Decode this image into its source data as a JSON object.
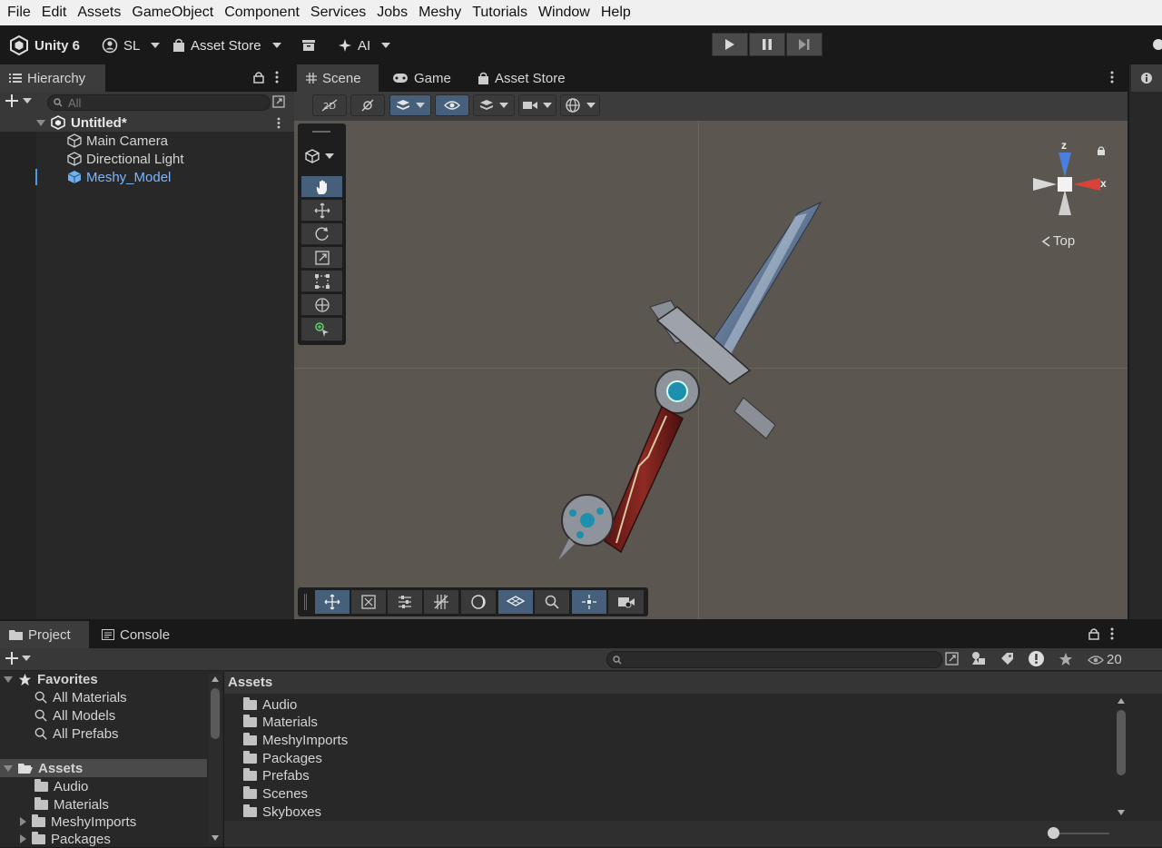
{
  "menu": [
    "File",
    "Edit",
    "Assets",
    "GameObject",
    "Component",
    "Services",
    "Jobs",
    "Meshy",
    "Tutorials",
    "Window",
    "Help"
  ],
  "toolbar": {
    "app_label": "Unity 6",
    "account_label": "SL",
    "asset_store_label": "Asset Store",
    "ai_label": "AI"
  },
  "hierarchy": {
    "tab_label": "Hierarchy",
    "search_placeholder": "All",
    "scene_name": "Untitled*",
    "items": [
      "Main Camera",
      "Directional Light",
      "Meshy_Model"
    ],
    "selected_item": "Meshy_Model"
  },
  "scene_tabs": [
    "Scene",
    "Game",
    "Asset Store"
  ],
  "gizmo": {
    "z_label": "z",
    "x_label": "x",
    "view_label": "Top"
  },
  "project": {
    "tabs": [
      "Project",
      "Console"
    ],
    "visible_count": "20",
    "favorites_label": "Favorites",
    "favorites": [
      "All Materials",
      "All Models",
      "All Prefabs"
    ],
    "assets_label": "Assets",
    "tree_assets": [
      "Audio",
      "Materials",
      "MeshyImports",
      "Packages"
    ],
    "breadcrumb": "Assets",
    "folders": [
      "Audio",
      "Materials",
      "MeshyImports",
      "Packages",
      "Prefabs",
      "Scenes",
      "Skyboxes"
    ]
  },
  "colors": {
    "accent": "#46607c",
    "selected_text": "#7ab7ff",
    "scene_bg": "#5c5650"
  }
}
